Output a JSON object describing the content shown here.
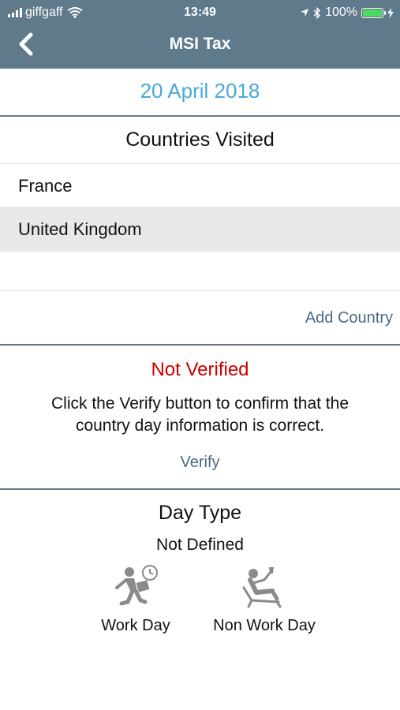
{
  "status_bar": {
    "carrier": "giffgaff",
    "time": "13:49",
    "battery": "100%"
  },
  "header": {
    "title": "MSI Tax"
  },
  "date": "20 April 2018",
  "countries": {
    "title": "Countries Visited",
    "items": [
      {
        "label": "France",
        "selected": false
      },
      {
        "label": "United Kingdom",
        "selected": true
      }
    ],
    "add_label": "Add Country"
  },
  "verification": {
    "status": "Not Verified",
    "message": "Click the Verify button to confirm that the country day information is correct.",
    "verify_label": "Verify"
  },
  "day_type": {
    "title": "Day Type",
    "value": "Not Defined",
    "options": [
      {
        "label": "Work Day",
        "icon": "work-day-icon"
      },
      {
        "label": "Non Work Day",
        "icon": "non-work-day-icon"
      }
    ]
  },
  "colors": {
    "header": "#5f7a8b",
    "date": "#4aa8d8",
    "not_verified": "#cc0000",
    "link": "#4a6a85"
  }
}
